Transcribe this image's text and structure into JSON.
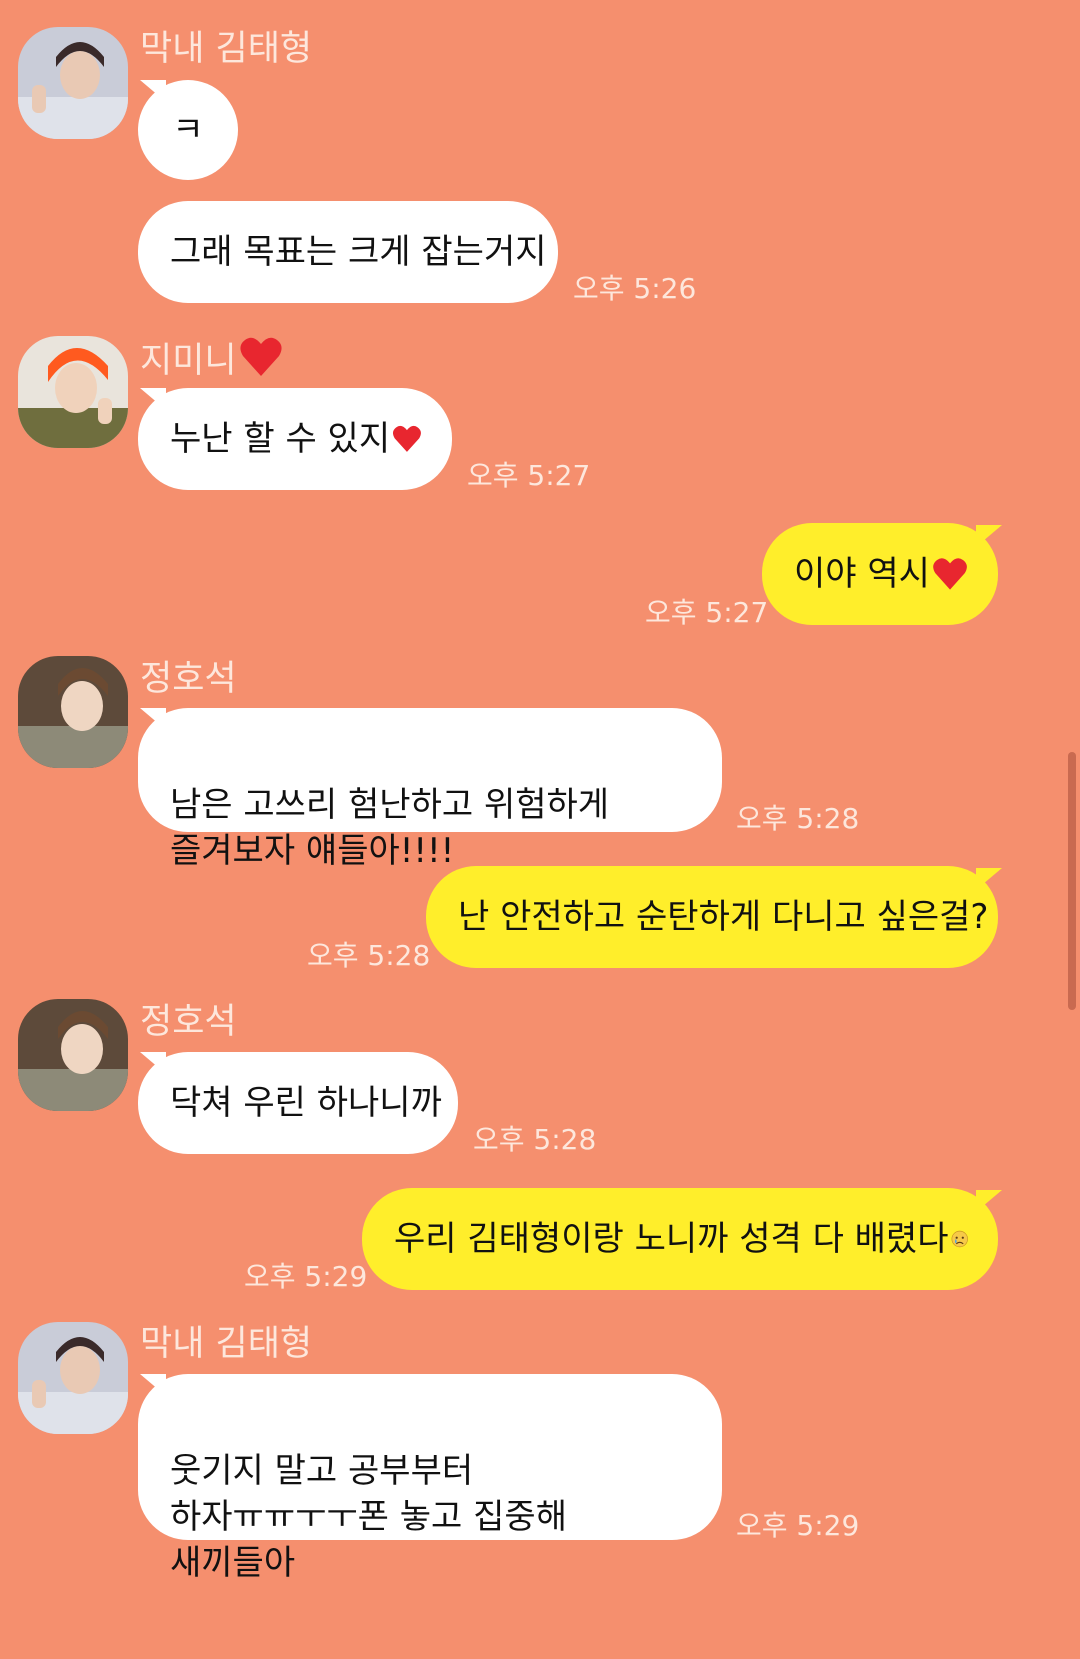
{
  "colors": {
    "background": "#f58f6e",
    "incoming_bubble": "#ffffff",
    "outgoing_bubble": "#ffee2b",
    "name_text": "#fde7dc"
  },
  "messages": [
    {
      "sender": "막내 김태형",
      "text": "ㅋ"
    },
    {
      "text": "그래 목표는 크게 잡는거지",
      "time": "오후 5:26"
    },
    {
      "sender": "지미니",
      "sender_emoji": "heart-icon",
      "text": "누난 할 수 있지",
      "text_emoji": "heart-icon",
      "time": "오후 5:27"
    },
    {
      "mine": true,
      "text": "이야 역시",
      "text_emoji": "heart-icon",
      "time": "오후 5:27"
    },
    {
      "sender": "정호석",
      "text": "남은 고쓰리 험난하고 위험하게\n즐겨보자 얘들아!!!!",
      "time": "오후 5:28"
    },
    {
      "mine": true,
      "text": "난 안전하고 순탄하게 다니고 싶은걸?",
      "time": "오후 5:28"
    },
    {
      "sender": "정호석",
      "text": "닥쳐 우린 하나니까",
      "time": "오후 5:28"
    },
    {
      "mine": true,
      "text": "우리 김태형이랑 노니까 성격 다 배렸다",
      "text_emoji": "sad-face-emoji",
      "time": "오후 5:29"
    },
    {
      "sender": "막내 김태형",
      "text": "웃기지 말고 공부부터\n하자ㅠㅠㅜㅜ폰 놓고 집중해\n새끼들아",
      "time": "오후 5:29"
    }
  ]
}
